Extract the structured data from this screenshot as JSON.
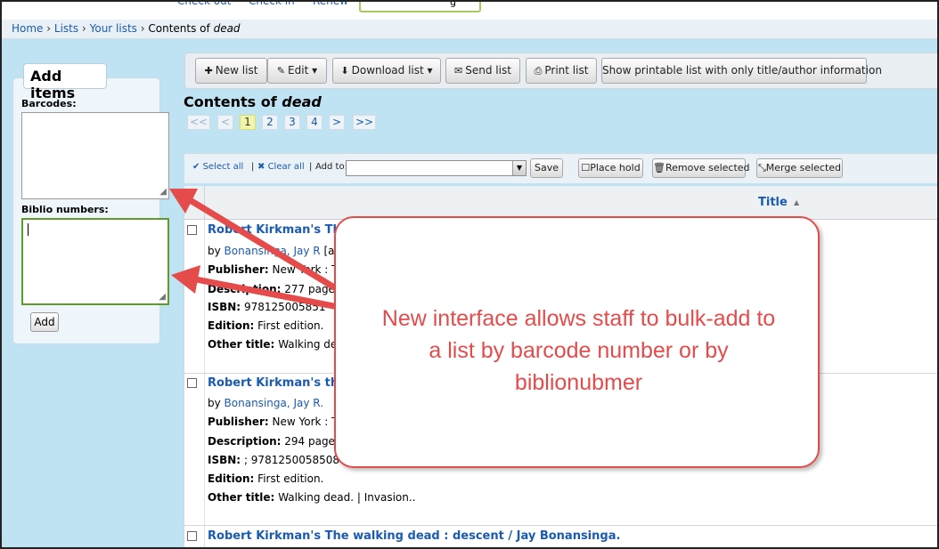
{
  "top": {
    "links": [
      "Check out",
      "Check in",
      "Renew"
    ],
    "search_value": "g"
  },
  "breadcrumbs": {
    "home": "Home",
    "lists": "Lists",
    "your_lists": "Your lists",
    "current_prefix": "Contents of",
    "current_name": "dead"
  },
  "add_items": {
    "legend": "Add items",
    "barcodes_label": "Barcodes:",
    "biblio_label": "Biblio numbers:",
    "add_button": "Add"
  },
  "toolbar": {
    "new_list": "New list",
    "edit": "Edit",
    "download_list": "Download list",
    "send_list": "Send list",
    "print_list": "Print list",
    "printable": "Show printable list with only title/author information"
  },
  "heading": {
    "prefix": "Contents of",
    "name": "dead"
  },
  "pagination": {
    "first": "<<",
    "prev": "<",
    "pages": [
      "1",
      "2",
      "3",
      "4"
    ],
    "current": "1",
    "next": ">",
    "last": ">>"
  },
  "selection": {
    "select_all": "Select all",
    "clear_all": "Clear all",
    "add_to": "Add to:",
    "save": "Save",
    "place_hold": "Place hold",
    "remove_selected": "Remove selected",
    "merge_selected": "Merge selected"
  },
  "table": {
    "title_header": "Title"
  },
  "results": [
    {
      "title": "Robert Kirkman's Th",
      "by": "by",
      "author": "Bonansinga, Jay R",
      "author_suffix": " [a",
      "publisher_label": "Publisher:",
      "publisher": "New York : T",
      "description_label": "Description:",
      "description": "277 pages",
      "isbn_label": "ISBN:",
      "isbn": "978125005851",
      "edition_label": "Edition:",
      "edition": "First edition.",
      "other_label": "Other title:",
      "other": "Walking dead"
    },
    {
      "title": "Robert Kirkman's the",
      "by": "by",
      "author": "Bonansinga, Jay R.",
      "publisher_label": "Publisher:",
      "publisher": "New York : T",
      "description_label": "Description:",
      "description": "294 pages",
      "isbn_label": "ISBN:",
      "isbn": "; 9781250058508 (",
      "edition_label": "Edition:",
      "edition": "First edition.",
      "other_label": "Other title:",
      "other": "Walking dead.  |  Invasion.."
    },
    {
      "title": "Robert Kirkman's The walking dead : descent / Jay Bonansinga."
    }
  ],
  "callout": {
    "line1": "New interface allows staff to bulk-add to",
    "line2": "a list by barcode number or by",
    "line3": "biblionubmer"
  },
  "colors": {
    "accent": "#1a5bb0",
    "callout": "#e64b4b",
    "background": "#bfe3f3"
  }
}
